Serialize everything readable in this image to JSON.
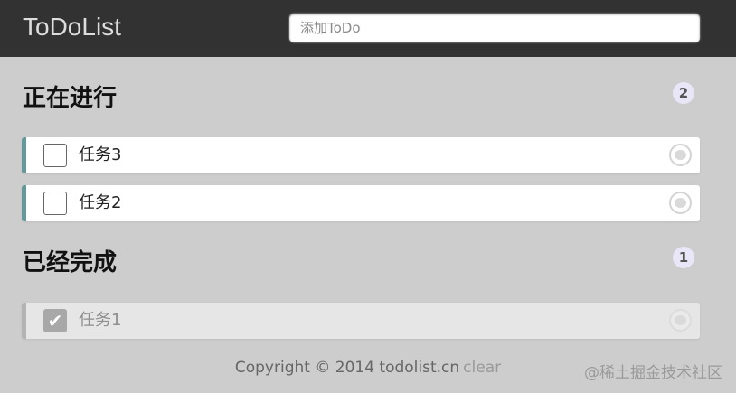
{
  "header": {
    "logo": "ToDoList",
    "input_placeholder": "添加ToDo"
  },
  "ongoing": {
    "title": "正在进行",
    "count": "2",
    "items": [
      {
        "label": "任务3",
        "checked": false
      },
      {
        "label": "任务2",
        "checked": false
      }
    ]
  },
  "done": {
    "title": "已经完成",
    "count": "1",
    "items": [
      {
        "label": "任务1",
        "checked": true,
        "check_glyph": "✔"
      }
    ]
  },
  "footer": {
    "copyright": "Copyright © 2014 todolist.cn",
    "clear": "clear"
  },
  "watermark": "@稀土掘金技术社区",
  "colors": {
    "header_bg": "#323232",
    "page_bg": "#cdcdcd",
    "ongoing_accent": "#629a9c",
    "done_accent": "#b3b3b3"
  }
}
